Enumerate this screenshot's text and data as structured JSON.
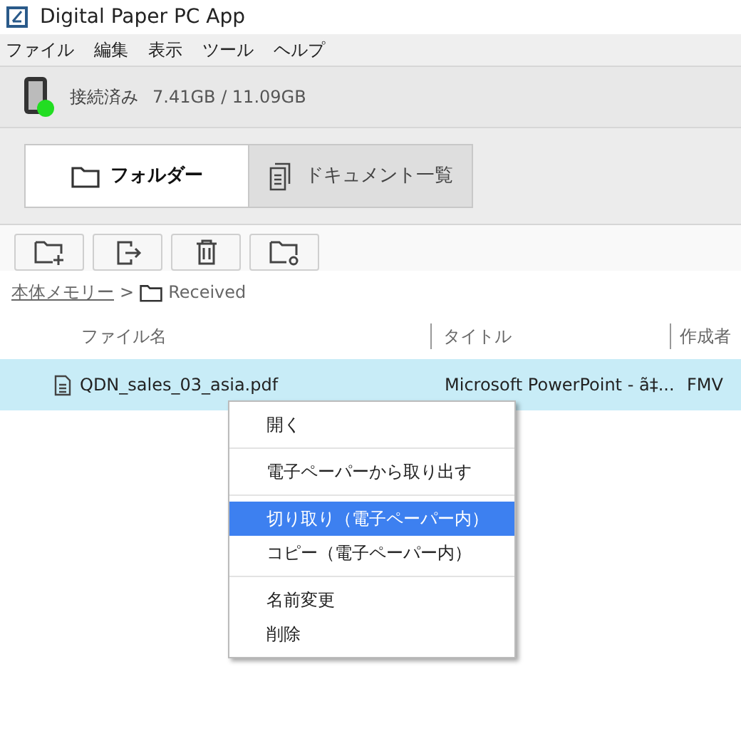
{
  "window": {
    "title": "Digital Paper PC App"
  },
  "menu_bar": [
    "ファイル",
    "編集",
    "表示",
    "ツール",
    "ヘルプ"
  ],
  "status": {
    "connected": true,
    "label": "接続済み",
    "storage": "7.41GB / 11.09GB"
  },
  "tabs": [
    {
      "label": "フォルダー",
      "selected": true,
      "kind": "folder"
    },
    {
      "label": "ドキュメント一覧",
      "selected": false,
      "kind": "documents"
    }
  ],
  "toolbar": [
    {
      "kind": "new-folder"
    },
    {
      "kind": "export"
    },
    {
      "kind": "delete"
    },
    {
      "kind": "sync-folder"
    }
  ],
  "breadcrumb": {
    "root": "本体メモリー",
    "separator": ">",
    "current": "Received"
  },
  "table": {
    "columns": [
      "ファイル名",
      "タイトル",
      "作成者"
    ],
    "rows": [
      {
        "file": "QDN_sales_03_asia.pdf",
        "title": "Microsoft PowerPoint - ã‡...",
        "author": "FMV",
        "selected": true
      }
    ]
  },
  "context_menu": {
    "groups": [
      [
        {
          "label": "開く",
          "selected": false
        }
      ],
      [
        {
          "label": "電子ペーパーから取り出す",
          "selected": false
        }
      ],
      [
        {
          "label": "切り取り（電子ペーパー内）",
          "selected": true
        },
        {
          "label": "コピー（電子ペーパー内）",
          "selected": false
        }
      ],
      [
        {
          "label": "名前変更",
          "selected": false
        },
        {
          "label": "削除",
          "selected": false
        }
      ]
    ]
  }
}
